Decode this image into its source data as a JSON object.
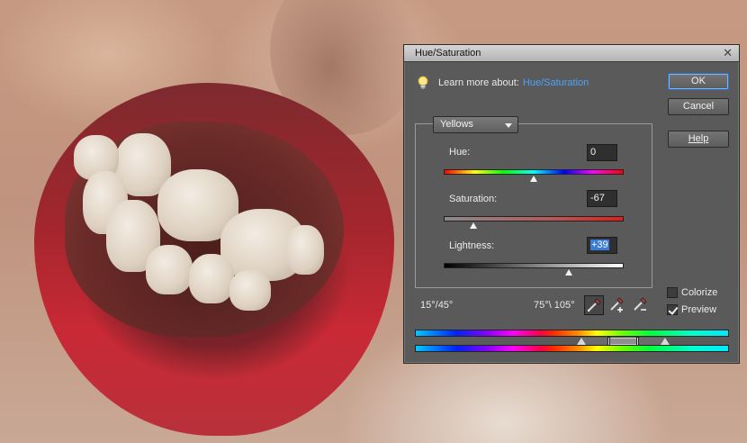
{
  "dialog": {
    "title": "Hue/Saturation",
    "close_symbol": "✕"
  },
  "learn": {
    "text": "Learn more about:",
    "link": "Hue/Saturation",
    "icon": "lightbulb-icon"
  },
  "buttons": {
    "ok": "OK",
    "cancel": "Cancel",
    "help": "Help"
  },
  "edit": {
    "selected": "Yellows"
  },
  "hue": {
    "label": "Hue:",
    "value": "0",
    "range_min": -180,
    "range_max": 180
  },
  "saturation": {
    "label": "Saturation:",
    "value": "-67",
    "range_min": -100,
    "range_max": 100
  },
  "lightness": {
    "label": "Lightness:",
    "value": "+39",
    "range_min": -100,
    "range_max": 100
  },
  "ranges": {
    "left": "15°/45°",
    "right": "75°\\ 105°"
  },
  "options": {
    "colorize": {
      "label": "Colorize",
      "checked": false
    },
    "preview": {
      "label": "Preview",
      "checked": true
    }
  },
  "colors": {
    "link": "#4aa3ff",
    "selection": "#3a7bd5",
    "dialog_bg": "#5a5a5a"
  }
}
